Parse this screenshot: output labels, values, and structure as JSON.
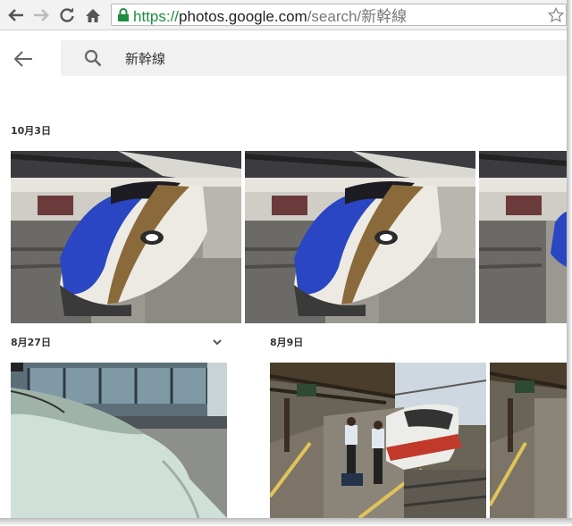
{
  "browser": {
    "url_scheme": "https://",
    "url_host": "photos.google.com",
    "url_path": "/search/新幹線"
  },
  "search": {
    "query": "新幹線"
  },
  "groups": [
    {
      "date": "10月3日"
    },
    {
      "date": "8月27日"
    },
    {
      "date": "8月9日"
    }
  ]
}
